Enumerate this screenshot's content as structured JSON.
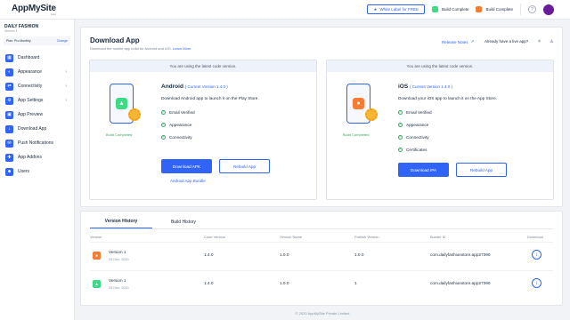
{
  "brand": {
    "logo_text": "AppMySite",
    "logo_sub": "beta"
  },
  "topbar": {
    "white_label": "White Label for FREE",
    "android_build": "Build Complete",
    "ios_build": "Build Complete",
    "help": "?"
  },
  "sidebar": {
    "app_name": "DAILY FASHION",
    "app_version": "Version 1",
    "plan_name": "Plan: Pro Monthly",
    "plan_change": "Change",
    "items": [
      {
        "label": "Dashboard",
        "icon": "▦",
        "chevron": false
      },
      {
        "label": "Appearance",
        "icon": "◐",
        "chevron": true
      },
      {
        "label": "Connectivity",
        "icon": "⇄",
        "chevron": true
      },
      {
        "label": "App Settings",
        "icon": "⚙",
        "chevron": true
      },
      {
        "label": "App Preview",
        "icon": "▣",
        "chevron": false
      },
      {
        "label": "Download App",
        "icon": "↓",
        "chevron": false
      },
      {
        "label": "Push Notifications",
        "icon": "✉",
        "chevron": false
      },
      {
        "label": "App Addons",
        "icon": "✚",
        "chevron": false
      },
      {
        "label": "Users",
        "icon": "☻",
        "chevron": false
      }
    ],
    "chevron": "›"
  },
  "download": {
    "title": "Download App",
    "subtitle": "Download the mobile app build for Android and iOS.",
    "learn_more": "Learn More",
    "release_notes": "Release Notes",
    "already": "Already have a live app?"
  },
  "android": {
    "banner": "You are using the latest code version.",
    "name": "Android",
    "version_note": "( Current Version 1.4.0 )",
    "description": "Download Android app to launch it on the Play Store.",
    "features": [
      "Email Verified",
      "Appearance",
      "Connectivity"
    ],
    "build_status": "Build Completed",
    "download_btn": "Download APK",
    "rebuild_btn": "Rebuild App",
    "bundle_link": "Android App Bundle"
  },
  "ios": {
    "banner": "You are using the latest code version.",
    "name": "iOS",
    "version_note": "( Current Version 1.4.0 )",
    "description": "Download your iOS app to launch it on the App Store.",
    "features": [
      "Email Verified",
      "Appearance",
      "Connectivity",
      "Certificates"
    ],
    "build_status": "Build Completed",
    "download_btn": "Download IPA",
    "rebuild_btn": "Rebuild App"
  },
  "history": {
    "tabs": [
      "Version History",
      "Build History"
    ],
    "columns": [
      "Version",
      "Code Version",
      "Version Name",
      "Publish Version",
      "Bundle ID",
      "Download"
    ],
    "rows": [
      {
        "platform": "ios",
        "version": "Version 1",
        "date": "03 Dec, 2020",
        "code_version": "1.4.0",
        "version_name": "1.0.0",
        "publish_version": "1.0.0",
        "bundle_id": "com.dailyfashionstore.app27390"
      },
      {
        "platform": "android",
        "version": "Version 1",
        "date": "03 Dec, 2020",
        "code_version": "1.4.0",
        "version_name": "1.0.0",
        "publish_version": "1",
        "bundle_id": "com.dailyfashionstore.app27390"
      }
    ]
  },
  "footer": "© 2020 AppMySite Private Limited",
  "colors": {
    "accent": "#3064f6",
    "success": "#27ae60",
    "android": "#3ddc84",
    "ios": "#f57c32",
    "avatar": "#6a1b9a"
  }
}
